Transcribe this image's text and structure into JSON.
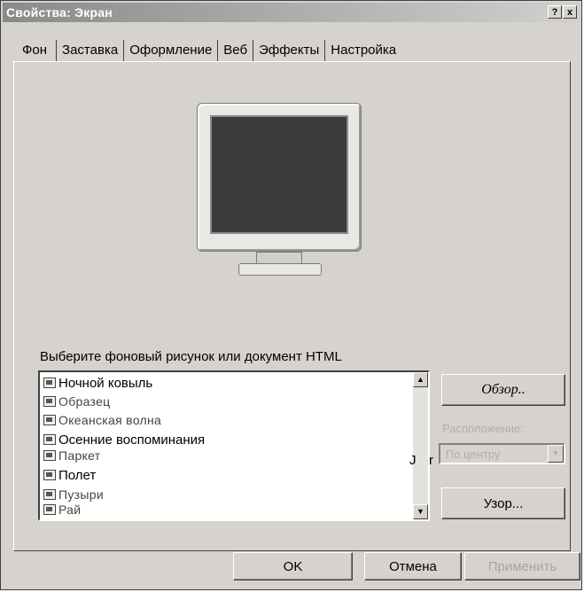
{
  "window": {
    "title": "Свойства: Экран",
    "help_glyph": "?",
    "close_glyph": "x"
  },
  "tabs": [
    {
      "label": "Фон"
    },
    {
      "label": "Заставка"
    },
    {
      "label": "Оформление"
    },
    {
      "label": "Веб"
    },
    {
      "label": "Эффекты"
    },
    {
      "label": "Настройка"
    }
  ],
  "wallpaper": {
    "prompt": "Выберите фоновый рисунок или документ HTML",
    "items": [
      {
        "label": "Ночной ковыль"
      },
      {
        "label": "Образец"
      },
      {
        "label": "Океанская волна"
      },
      {
        "label": "Осенние воспоминания"
      },
      {
        "label": "Паркет"
      },
      {
        "label": "Полет"
      },
      {
        "label": "Пузыри"
      },
      {
        "label": "Рай"
      }
    ],
    "browse_button": "Обзор..",
    "pattern_button": "Узор...",
    "arrangement_label": "Расположение:",
    "arrangement_value": "По центру",
    "stray_j": "J",
    "stray_r": "r"
  },
  "footer": {
    "ok": "OK",
    "cancel": "Отмена",
    "apply": "Применить"
  },
  "icons": {
    "list_item": "image-file-icon",
    "scroll_up": "arrow-up-icon",
    "scroll_down": "arrow-down-icon",
    "select": "chevron-down-icon"
  },
  "colors": {
    "dialog_face": "#d6d3ce",
    "titlebar_start": "#8a8a8a",
    "titlebar_end": "#d0d0d0",
    "monitor_screen": "#3b3b3b",
    "disabled_text": "#a8a6a2"
  }
}
